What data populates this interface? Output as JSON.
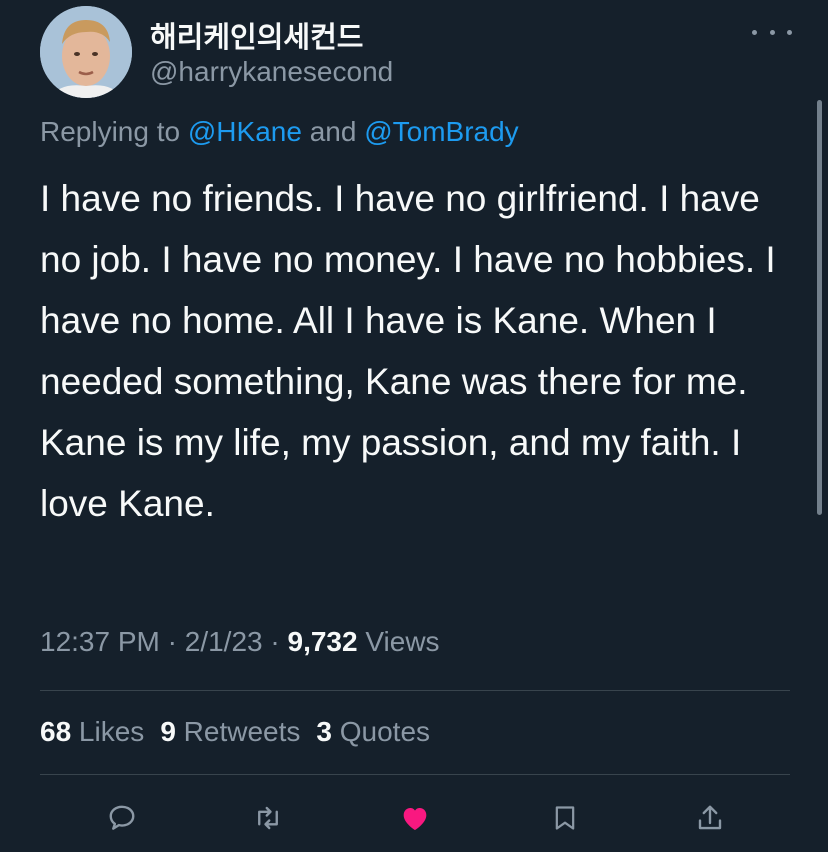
{
  "author": {
    "display_name": "해리케인의세컨드",
    "handle": "@harrykanesecond",
    "avatar": "avatar"
  },
  "reply": {
    "prefix": "Replying to ",
    "mention_1": "@HKane",
    "conjunction": " and ",
    "mention_2": "@TomBrady"
  },
  "tweet": {
    "text": "I have no friends. I have no girlfriend. I have no job. I have no money. I have no hobbies. I have no home. All I have is Kane. When I needed something, Kane was there for me. Kane is my life, my passion, and my faith. I love Kane."
  },
  "meta": {
    "time": "12:37 PM",
    "sep": " · ",
    "date": "2/1/23",
    "views_count": "9,732",
    "views_label": " Views"
  },
  "stats": {
    "likes_count": "68",
    "likes_label": " Likes",
    "retweets_count": "9",
    "retweets_label": " Retweets",
    "quotes_count": "3",
    "quotes_label": " Quotes"
  },
  "actions": [
    {
      "name": "reply-icon"
    },
    {
      "name": "retweet-icon"
    },
    {
      "name": "like-icon",
      "color": "#f91880"
    },
    {
      "name": "bookmark-icon"
    },
    {
      "name": "share-icon"
    }
  ],
  "colors": {
    "background": "#15202b",
    "accent": "#1d9bf0",
    "muted": "#8b98a5",
    "like": "#f91880"
  }
}
